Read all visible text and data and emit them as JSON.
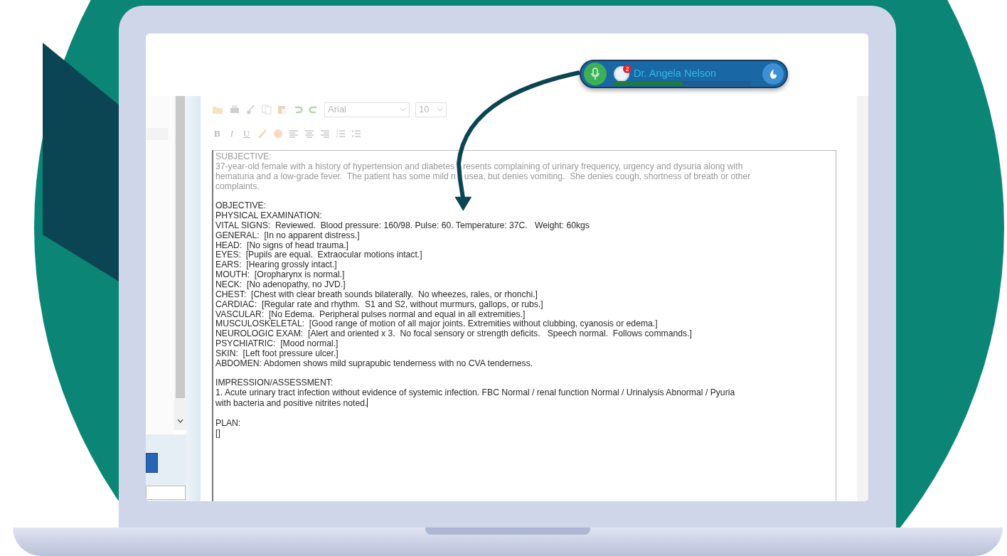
{
  "dictation_bar": {
    "notifications": "2",
    "user_name": "Dr. Angela Nelson",
    "level": 0.5
  },
  "toolbar": {
    "font": "Arial",
    "font_size": "10",
    "format_buttons": [
      "B",
      "I",
      "U"
    ]
  },
  "note": {
    "sections": [
      {
        "lines": [
          {
            "text": "SUBJECTIVE:",
            "faded": true,
            "cursor": false
          },
          {
            "parts": [
              "37-year-old female with a history of hypertension and diabetes",
              "resents complaining of urinary frequency, urgency and dysuria along with"
            ],
            "faded": true
          },
          {
            "parts": [
              "hematuria and a low-grade fever.  The patient has some mild n",
              "usea, but denies vomiting.  She denies cough, shortness of breath or other"
            ],
            "faded": true
          },
          {
            "text": "complaints.",
            "faded": true,
            "cursor": false
          }
        ]
      },
      {
        "lines": [
          {
            "text": "OBJECTIVE:",
            "faded": false,
            "cursor": false
          },
          {
            "text": "PHYSICAL EXAMINATION:",
            "faded": false,
            "cursor": false
          },
          {
            "text": "VITAL SIGNS:  Reviewed.  Blood pressure: 160/98. Pulse: 60. Temperature: 37C.   Weight: 60kgs",
            "faded": false,
            "cursor": false
          },
          {
            "text": "GENERAL:  [In no apparent distress.]",
            "faded": false,
            "cursor": false
          },
          {
            "text": "HEAD:  [No signs of head trauma.]",
            "faded": false,
            "cursor": false
          },
          {
            "text": "EYES:  [Pupils are equal.  Extraocular motions intact.]",
            "faded": false,
            "cursor": false
          },
          {
            "text": "EARS:  [Hearing grossly intact.]",
            "faded": false,
            "cursor": false
          },
          {
            "text": "MOUTH:  [Oropharynx is normal.]",
            "faded": false,
            "cursor": false
          },
          {
            "text": "NECK:  [No adenopathy, no JVD.]",
            "faded": false,
            "cursor": false
          },
          {
            "text": "CHEST:  [Chest with clear breath sounds bilaterally.  No wheezes, rales, or rhonchi.]",
            "faded": false,
            "cursor": false
          },
          {
            "text": "CARDIAC:  [Regular rate and rhythm.  S1 and S2, without murmurs, gallops, or rubs.]",
            "faded": false,
            "cursor": false
          },
          {
            "text": "VASCULAR:  [No Edema.  Peripheral pulses normal and equal in all extremities.]",
            "faded": false,
            "cursor": false
          },
          {
            "text": "MUSCULOSKELETAL:  [Good range of motion of all major joints. Extremities without clubbing, cyanosis or edema.]",
            "faded": false,
            "cursor": false
          },
          {
            "text": "NEUROLOGIC EXAM:  [Alert and oriented x 3.  No focal sensory or strength deficits.   Speech normal.  Follows commands.]",
            "faded": false,
            "cursor": false
          },
          {
            "text": "PSYCHIATRIC:  [Mood normal.]",
            "faded": false,
            "cursor": false
          },
          {
            "text": "SKIN:  [Left foot pressure ulcer.]",
            "faded": false,
            "cursor": false
          },
          {
            "text": "ABDOMEN: Abdomen shows mild suprapubic tenderness with no CVA tenderness.",
            "faded": false,
            "cursor": false
          }
        ]
      },
      {
        "lines": [
          {
            "text": "IMPRESSION/ASSESSMENT:",
            "faded": false,
            "cursor": false
          },
          {
            "text": "1. Acute urinary tract infection without evidence of systemic infection. FBC Normal / renal function Normal / Urinalysis Abnormal / Pyuria",
            "faded": false,
            "cursor": false
          },
          {
            "text": "with bacteria and positive nitrites noted.",
            "faded": false,
            "cursor": true
          }
        ]
      },
      {
        "lines": [
          {
            "text": "PLAN:",
            "faded": false,
            "cursor": false
          },
          {
            "text": "[]",
            "faded": false,
            "cursor": false
          }
        ]
      }
    ]
  }
}
